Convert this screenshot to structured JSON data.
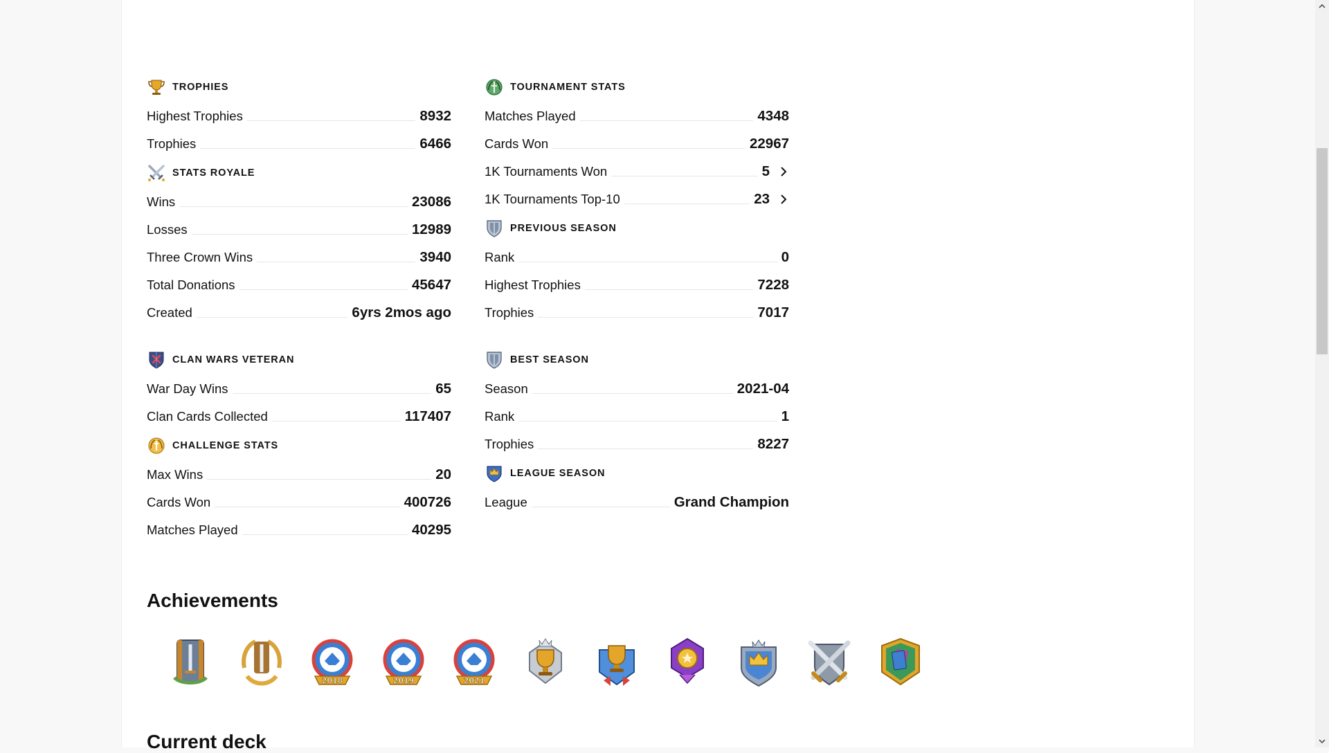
{
  "left_column": [
    {
      "title": "Trophies",
      "icon": "trophy-icon",
      "rows": [
        {
          "label": "Highest Trophies",
          "value": "8932"
        },
        {
          "label": "Trophies",
          "value": "6466"
        }
      ]
    },
    {
      "title": "Stats Royale",
      "icon": "crossed-swords-icon",
      "rows": [
        {
          "label": "Wins",
          "value": "23086"
        },
        {
          "label": "Losses",
          "value": "12989"
        },
        {
          "label": "Three Crown Wins",
          "value": "3940"
        },
        {
          "label": "Total Donations",
          "value": "45647"
        },
        {
          "label": "Created",
          "value": "6yrs 2mos ago"
        }
      ]
    },
    {
      "title": "Clan Wars Veteran",
      "icon": "clan-wars-shield-icon",
      "rows": [
        {
          "label": "War Day Wins",
          "value": "65"
        },
        {
          "label": "Clan Cards Collected",
          "value": "117407"
        }
      ]
    },
    {
      "title": "Challenge Stats",
      "icon": "challenge-laurel-icon",
      "rows": [
        {
          "label": "Max Wins",
          "value": "20"
        },
        {
          "label": "Cards Won",
          "value": "400726"
        },
        {
          "label": "Matches Played",
          "value": "40295"
        }
      ]
    }
  ],
  "right_column": [
    {
      "title": "Tournament Stats",
      "icon": "tournament-laurel-icon",
      "rows": [
        {
          "label": "Matches Played",
          "value": "4348"
        },
        {
          "label": "Cards Won",
          "value": "22967"
        },
        {
          "label": "1K Tournaments Won",
          "value": "5",
          "link": true
        },
        {
          "label": "1K Tournaments Top-10",
          "value": "23",
          "link": true
        }
      ]
    },
    {
      "title": "Previous Season",
      "icon": "season-shield-icon",
      "rows": [
        {
          "label": "Rank",
          "value": "0"
        },
        {
          "label": "Highest Trophies",
          "value": "7228"
        },
        {
          "label": "Trophies",
          "value": "7017"
        }
      ]
    },
    {
      "title": "Best Season",
      "icon": "season-shield-icon",
      "rows": [
        {
          "label": "Season",
          "value": "2021-04"
        },
        {
          "label": "Rank",
          "value": "1"
        },
        {
          "label": "Trophies",
          "value": "8227"
        }
      ]
    },
    {
      "title": "League Season",
      "icon": "league-crown-icon",
      "rows": [
        {
          "label": "League",
          "value": "Grand Champion"
        }
      ]
    }
  ],
  "achievements": {
    "title": "Achievements",
    "badges": [
      {
        "icon": "sword-banner-green-icon",
        "year": ""
      },
      {
        "icon": "sword-laurel-gold-icon",
        "year": ""
      },
      {
        "icon": "crl-badge-icon",
        "year": "2018"
      },
      {
        "icon": "crl-badge-icon",
        "year": "2019"
      },
      {
        "icon": "crl-badge-icon",
        "year": "2021"
      },
      {
        "icon": "trophy-crown-silver-icon",
        "year": ""
      },
      {
        "icon": "trophy-blue-ribbon-icon",
        "year": ""
      },
      {
        "icon": "medal-purple-icon",
        "year": ""
      },
      {
        "icon": "king-crown-shield-icon",
        "year": ""
      },
      {
        "icon": "crossed-swords-shield-icon",
        "year": ""
      },
      {
        "icon": "cards-gold-frame-icon",
        "year": ""
      }
    ]
  },
  "current_deck": {
    "title": "Current deck"
  },
  "colors": {
    "gold": "#e3a52a",
    "blue": "#3f7fd0",
    "purple": "#8a3fc9",
    "green": "#3b9a5a"
  }
}
